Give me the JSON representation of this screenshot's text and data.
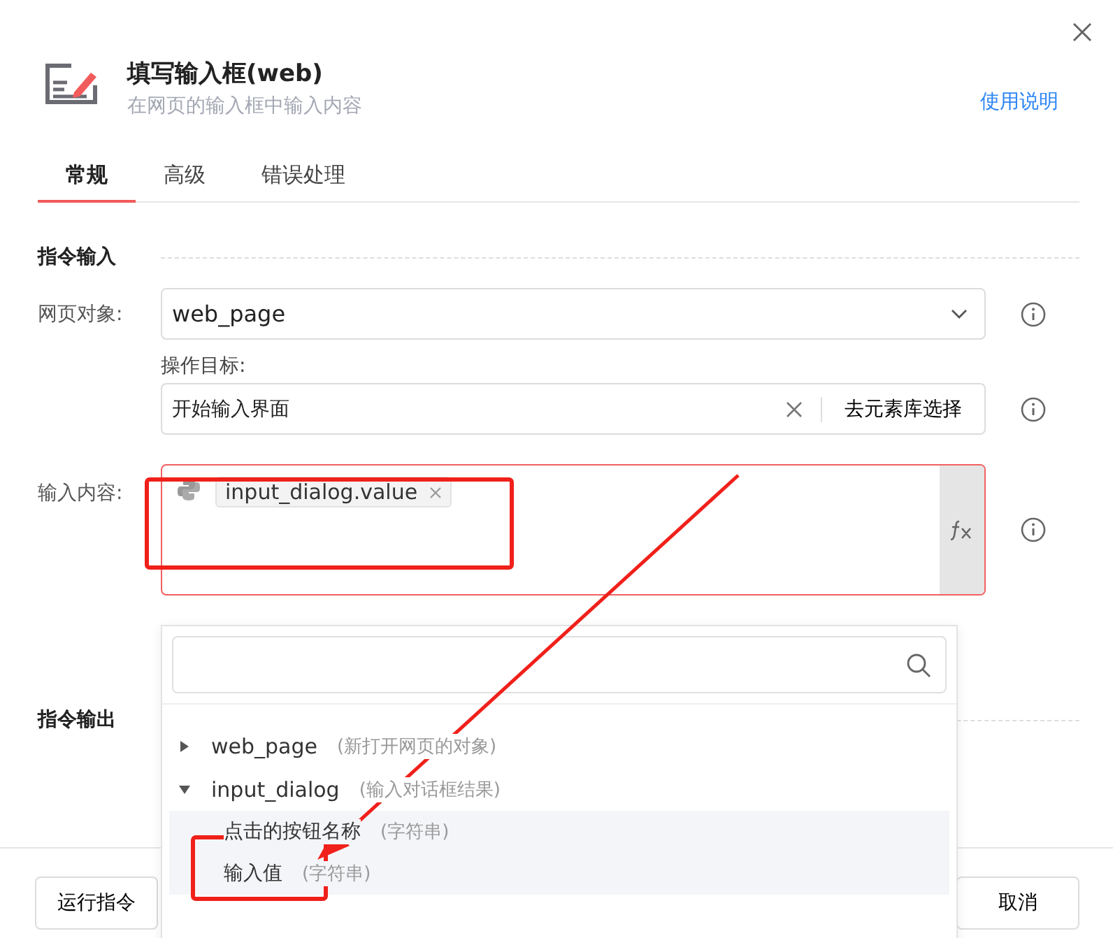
{
  "dialog": {
    "title": "填写输入框(web)",
    "subtitle": "在网页的输入框中输入内容",
    "help_link": "使用说明"
  },
  "tabs": [
    {
      "label": "常规",
      "selected": true
    },
    {
      "label": "高级",
      "selected": false
    },
    {
      "label": "错误处理",
      "selected": false
    }
  ],
  "input_section": {
    "title": "指令输入",
    "fields": [
      {
        "kind": "select",
        "label": "网页对象:",
        "value": "web_page"
      },
      {
        "kind": "target",
        "label": "操作目标:",
        "value": "开始输入界面",
        "action": "去元素库选择"
      },
      {
        "kind": "expression",
        "label": "输入内容:",
        "token": "input_dialog.value"
      }
    ]
  },
  "dropdown": {
    "items": [
      {
        "name": "web_page",
        "note": "(新打开网页的对象)",
        "expanded": false
      },
      {
        "name": "input_dialog",
        "note": "(输入对话框结果)",
        "expanded": true,
        "children": [
          {
            "name": "点击的按钮名称",
            "note": "(字符串)"
          },
          {
            "name": "输入值",
            "note": "(字符串)"
          }
        ]
      }
    ]
  },
  "output_section": {
    "title": "指令输出"
  },
  "footer": {
    "buttons": [
      "运行指令",
      "取消"
    ]
  }
}
